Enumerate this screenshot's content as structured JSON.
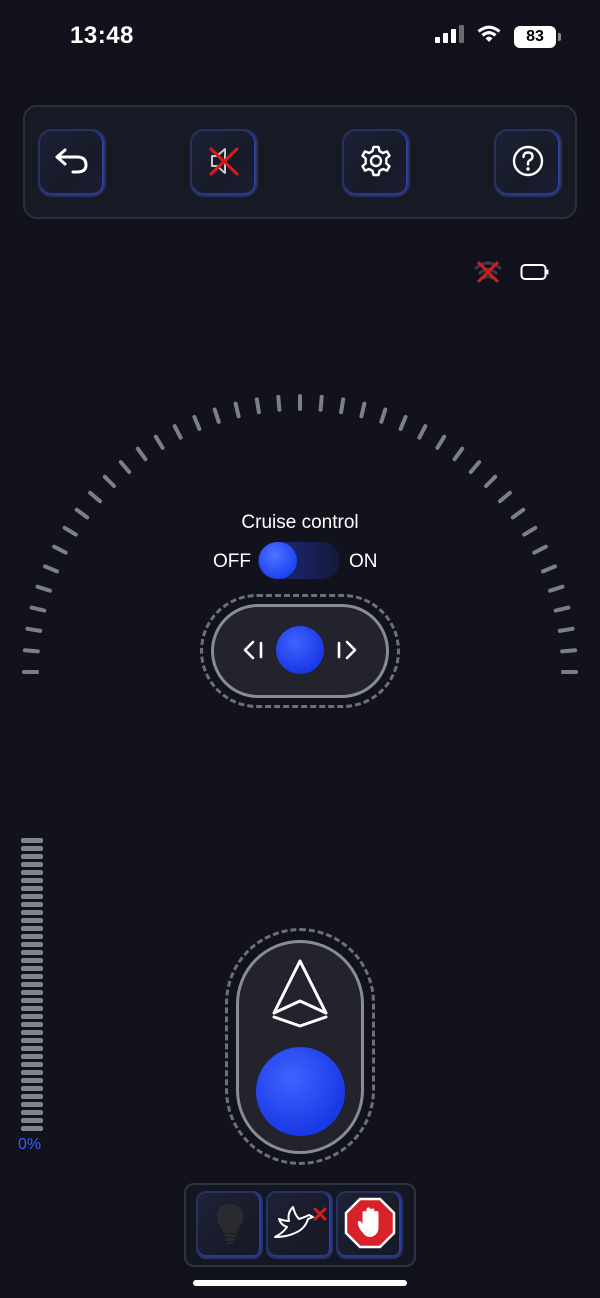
{
  "status_bar": {
    "time": "13:48",
    "battery_level": "83",
    "icons": [
      "cellular-signal-icon",
      "wifi-icon",
      "battery-icon"
    ]
  },
  "toolbar": {
    "buttons": [
      {
        "icon": "back-arrow-icon"
      },
      {
        "icon": "sound-muted-icon"
      },
      {
        "icon": "gear-icon"
      },
      {
        "icon": "help-icon"
      }
    ]
  },
  "connection_status": {
    "icons": [
      "signal-disconnected-icon",
      "device-battery-icon"
    ],
    "disconnected_color": "#d81c1c"
  },
  "cruise_control": {
    "label": "Cruise control",
    "off_label": "OFF",
    "on_label": "ON",
    "enabled": false
  },
  "throttle": {
    "value_text": "0%",
    "value": 0,
    "segments": 37
  },
  "action_bar": {
    "buttons": [
      {
        "icon": "light-bulb-icon"
      },
      {
        "icon": "bird-disabled-icon"
      },
      {
        "icon": "stop-hand-icon"
      }
    ]
  },
  "colors": {
    "background": "#11121b",
    "accent": "#1e45f2",
    "accent_text": "#3d5eff",
    "stop_red": "#d8222a"
  }
}
